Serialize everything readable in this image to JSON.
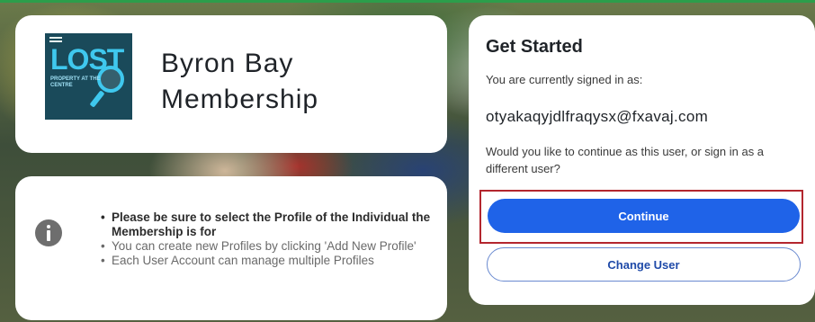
{
  "brand": {
    "title": "Byron Bay Membership",
    "logo": {
      "word": "LOST",
      "subtitle": "PROPERTY AT THE CENTRE"
    }
  },
  "info": {
    "items": [
      "Please be sure to select the Profile of the Individual the Membership is for",
      "You can create new Profiles by clicking 'Add New Profile'",
      "Each User Account can manage multiple Profiles"
    ]
  },
  "get_started": {
    "title": "Get Started",
    "signed_in_label": "You are currently signed in as:",
    "email": "otyakaqyjdlfraqysx@fxavaj.com",
    "question": "Would you like to continue as this user, or sign in as a different user?",
    "continue_label": "Continue",
    "change_user_label": "Change User"
  },
  "colors": {
    "primary_button": "#1f63e8",
    "highlight_border": "#b3262e",
    "frame_top": "#2c9e4b"
  }
}
